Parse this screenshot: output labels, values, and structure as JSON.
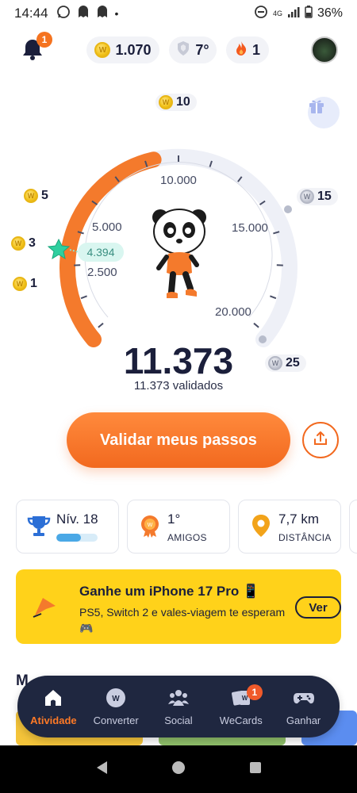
{
  "status_bar": {
    "time": "14:44",
    "network": "4G",
    "battery": "36%"
  },
  "top_bar": {
    "notifications_count": "1",
    "coins": "1.070",
    "streak_shield": "7°",
    "fire_streak": "1"
  },
  "gauge": {
    "scale_labels": [
      "2.500",
      "5.000",
      "10.000",
      "15.000",
      "20.000"
    ],
    "current_marker": "4.394",
    "rewards": [
      {
        "amount": "1",
        "type": "gold"
      },
      {
        "amount": "3",
        "type": "gold"
      },
      {
        "amount": "5",
        "type": "gold"
      },
      {
        "amount": "10",
        "type": "gold"
      },
      {
        "amount": "15",
        "type": "silver"
      },
      {
        "amount": "25",
        "type": "silver"
      }
    ],
    "steps_total": "11.373",
    "validated_text": "11.373 validados",
    "progress_fraction": 0.45
  },
  "actions": {
    "validate_label": "Validar meus passos"
  },
  "stats": {
    "level": {
      "value": "Nív. 18",
      "progress": 0.6
    },
    "friends": {
      "value": "1°",
      "label": "AMIGOS"
    },
    "distance": {
      "value": "7,7 km",
      "label": "DISTÂNCIA"
    }
  },
  "promo": {
    "title": "Ganhe um iPhone 17 Pro 📱",
    "subtitle": "PS5, Switch 2 e vales-viagem te esperam 🎮",
    "button": "Ver"
  },
  "section_peek": "M",
  "bottom_nav": {
    "items": [
      {
        "label": "Atividade",
        "icon": "home-icon",
        "active": true
      },
      {
        "label": "Converter",
        "icon": "coin-w-icon"
      },
      {
        "label": "Social",
        "icon": "people-icon"
      },
      {
        "label": "WeCards",
        "icon": "cards-icon",
        "badge": "1"
      },
      {
        "label": "Ganhar",
        "icon": "gamepad-icon"
      }
    ]
  },
  "colors": {
    "accent": "#f2691f",
    "dark": "#1b1f3b",
    "promo": "#ffd21a",
    "nav": "#1f2740"
  }
}
